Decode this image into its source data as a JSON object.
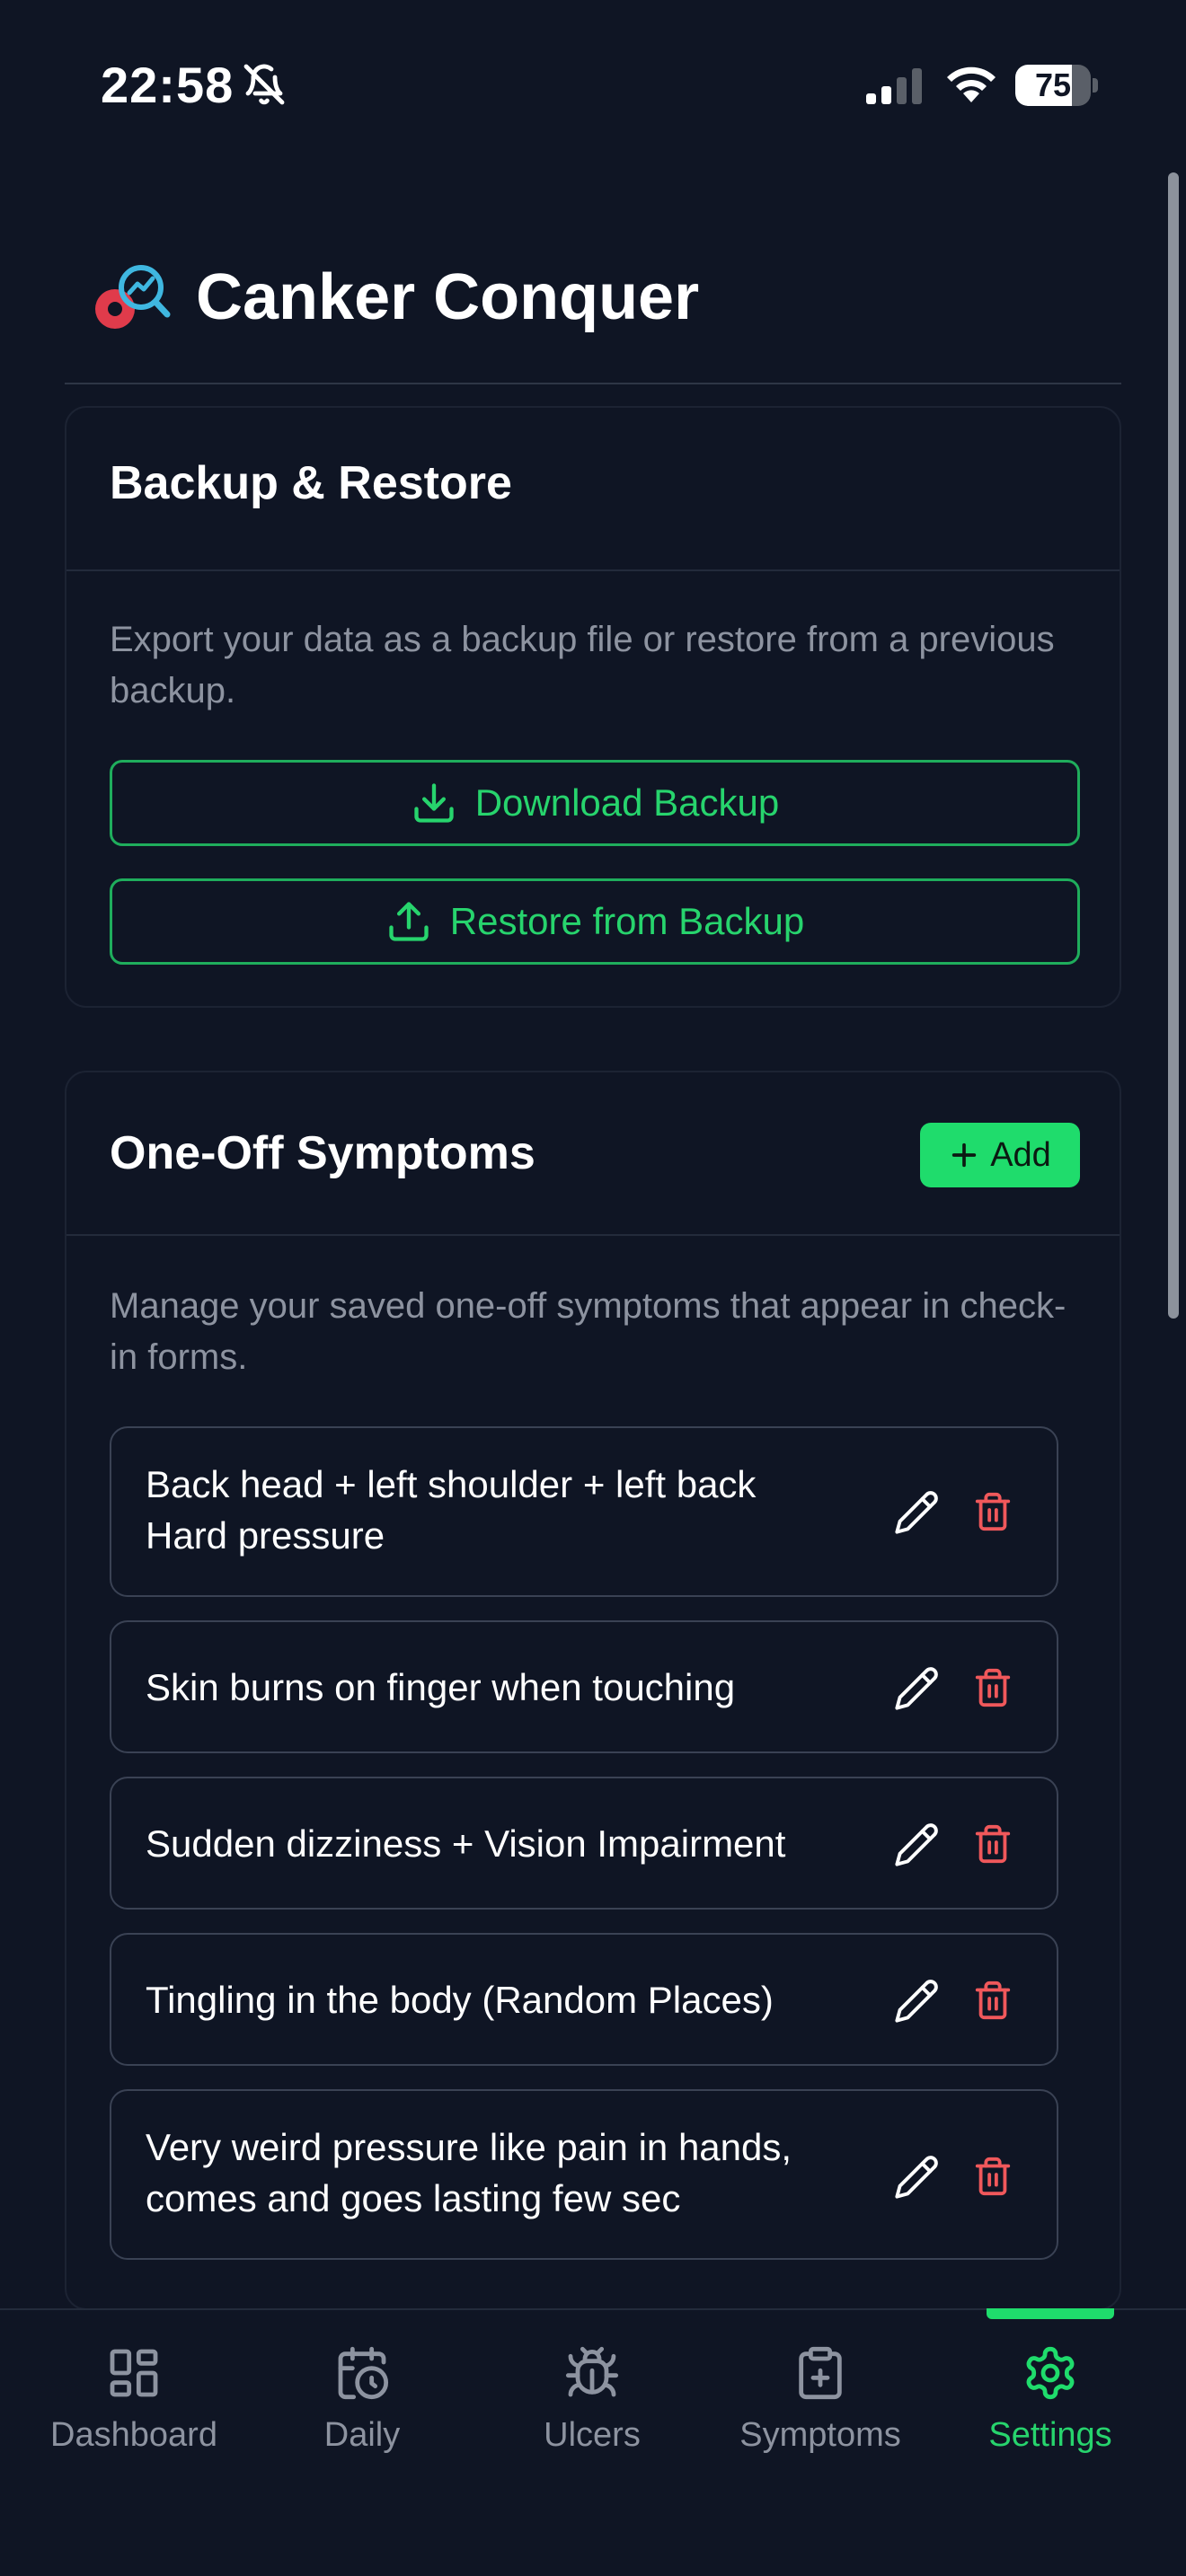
{
  "status_bar": {
    "time": "22:58",
    "battery": "75",
    "battery_level": 0.75
  },
  "app": {
    "title": "Canker Conquer"
  },
  "backup": {
    "title": "Backup & Restore",
    "description": "Export your data as a backup file or restore from a previous backup.",
    "download_label": "Download Backup",
    "restore_label": "Restore from Backup"
  },
  "symptoms": {
    "title": "One-Off Symptoms",
    "add_label": "Add",
    "description": "Manage your saved one-off symptoms that appear in check-in forms.",
    "items": [
      {
        "text": "Back head + left shoulder + left back Hard pressure"
      },
      {
        "text": "Skin burns on finger when touching"
      },
      {
        "text": "Sudden dizziness + Vision Impairment"
      },
      {
        "text": "Tingling in the body (Random Places)"
      },
      {
        "text": "Very weird pressure like pain in hands, comes and goes lasting few sec"
      }
    ]
  },
  "nav": {
    "items": [
      {
        "label": "Dashboard",
        "icon": "grid-icon"
      },
      {
        "label": "Daily",
        "icon": "calendar-clock-icon"
      },
      {
        "label": "Ulcers",
        "icon": "bug-icon"
      },
      {
        "label": "Symptoms",
        "icon": "clipboard-plus-icon"
      },
      {
        "label": "Settings",
        "icon": "gear-icon"
      }
    ],
    "active": "Settings"
  },
  "colors": {
    "background": "#0f1524",
    "accent": "#1fdc6c",
    "accent_text": "#27d46d",
    "danger": "#f0585b",
    "muted": "#8d93a0"
  }
}
